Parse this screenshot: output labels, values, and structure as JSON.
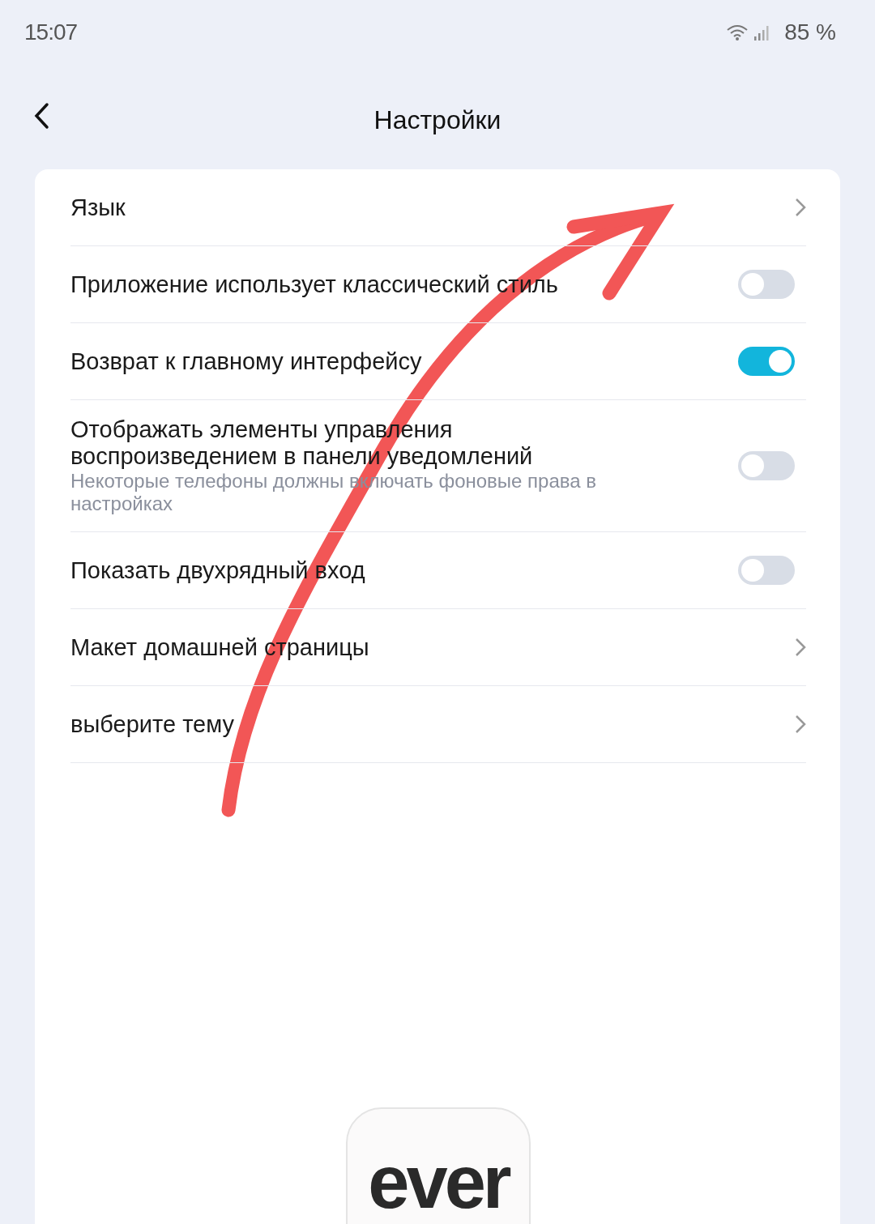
{
  "status_bar": {
    "time": "15:07",
    "battery": "85 %"
  },
  "header": {
    "title": "Настройки"
  },
  "settings": [
    {
      "kind": "link",
      "label": "Язык"
    },
    {
      "kind": "toggle",
      "label": "Приложение использует классический стиль",
      "on": false
    },
    {
      "kind": "toggle",
      "label": "Возврат к главному интерфейсу",
      "on": true
    },
    {
      "kind": "toggle",
      "label": "Отображать элементы управления воспроизведением в панели уведомлений",
      "hint": "Некоторые телефоны должны включать фоновые права в настройках",
      "on": false
    },
    {
      "kind": "toggle",
      "label": "Показать двухрядный вход",
      "on": false
    },
    {
      "kind": "link",
      "label": "Макет домашней страницы"
    },
    {
      "kind": "link",
      "label": "выберите тему"
    }
  ],
  "app_logo": {
    "text": "ever"
  }
}
